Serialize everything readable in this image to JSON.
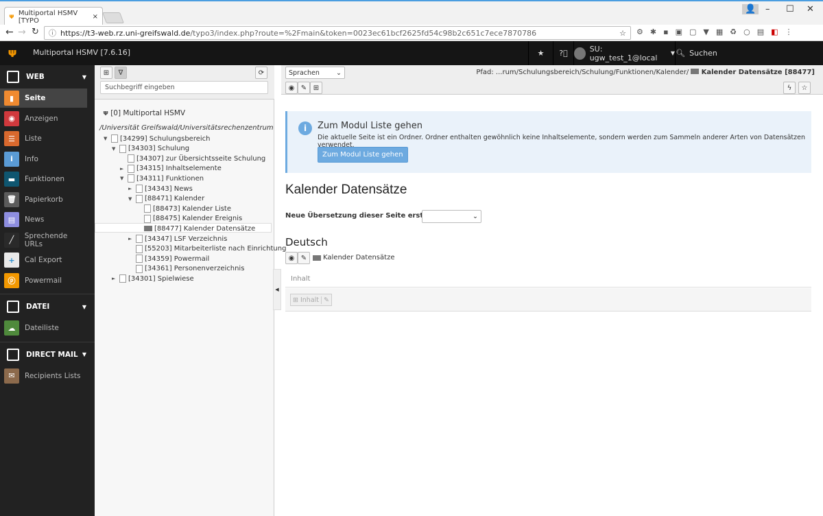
{
  "browser": {
    "tab_title": "Multiportal HSMV [TYPO",
    "url_host": "https://t3-web.rz.uni-greifswald.de",
    "url_path": "/typo3/index.php?route=%2Fmain&token=0023ec61bcf2625fd54c98b2c651c7ece7870786"
  },
  "topbar": {
    "site_name": "Multiportal HSMV [7.6.16]",
    "user": "SU: ugw_test_1@local",
    "search": "Suchen"
  },
  "sidebar": {
    "groups": [
      {
        "label": "WEB",
        "items": [
          {
            "label": "Seite",
            "color": "#f08a30"
          },
          {
            "label": "Anzeigen",
            "color": "#d0393d"
          },
          {
            "label": "Liste",
            "color": "#d9692e"
          },
          {
            "label": "Info",
            "color": "#5a9bd5"
          },
          {
            "label": "Funktionen",
            "color": "#0f5670"
          },
          {
            "label": "Papierkorb",
            "color": "#5b5b5b"
          },
          {
            "label": "News",
            "color": "#8e8ee0"
          },
          {
            "label": "Sprechende URLs",
            "color": "#2a2a2a"
          },
          {
            "label": "Cal Export",
            "color": "#e9e9e9"
          },
          {
            "label": "Powermail",
            "color": "#f29800"
          }
        ]
      },
      {
        "label": "DATEI",
        "items": [
          {
            "label": "Dateiliste",
            "color": "#4f8a3c"
          }
        ]
      },
      {
        "label": "DIRECT MAIL",
        "items": [
          {
            "label": "Recipients Lists",
            "color": "#8c6a4c"
          }
        ]
      }
    ]
  },
  "tree": {
    "search_placeholder": "Suchbegriff eingeben",
    "root": "[0] Multiportal HSMV",
    "mount_path": "/Universität Greifswald/Universitätsrechenzentrum",
    "nodes": [
      {
        "label": "[34299] Schulungsbereich"
      },
      {
        "label": "[34303] Schulung"
      },
      {
        "label": "[34307] zur Übersichtsseite Schulung"
      },
      {
        "label": "[34315] Inhaltselemente"
      },
      {
        "label": "[34311] Funktionen"
      },
      {
        "label": "[34343] News"
      },
      {
        "label": "[88471] Kalender"
      },
      {
        "label": "[88473] Kalender Liste"
      },
      {
        "label": "[88475] Kalender Ereignis"
      },
      {
        "label": "[88477] Kalender Datensätze"
      },
      {
        "label": "[34347] LSF Verzeichnis"
      },
      {
        "label": "[55203] Mitarbeiterliste nach Einrichtung"
      },
      {
        "label": "[34359] Powermail"
      },
      {
        "label": "[34361] Personenverzeichnis"
      },
      {
        "label": "[34301] Spielwiese"
      }
    ]
  },
  "docheader": {
    "language_select": "Sprachen",
    "path_label": "Pfad: ...rum/Schulungsbereich/Schulung/Funktionen/Kalender/",
    "path_current": "Kalender Datensätze [88477]"
  },
  "main": {
    "info_title": "Zum Modul Liste gehen",
    "info_text": "Die aktuelle Seite ist ein Ordner. Ordner enthalten gewöhnlich keine Inhaltselemente, sondern werden zum Sammeln anderer Arten von Datensätzen verwendet.",
    "info_button": "Zum Modul Liste gehen",
    "title": "Kalender Datensätze",
    "translation_label": "Neue Übersetzung dieser Seite erstellen",
    "language": "Deutsch",
    "page_name": "Kalender Datensätze",
    "column": "Inhalt",
    "new_content": "Inhalt"
  }
}
